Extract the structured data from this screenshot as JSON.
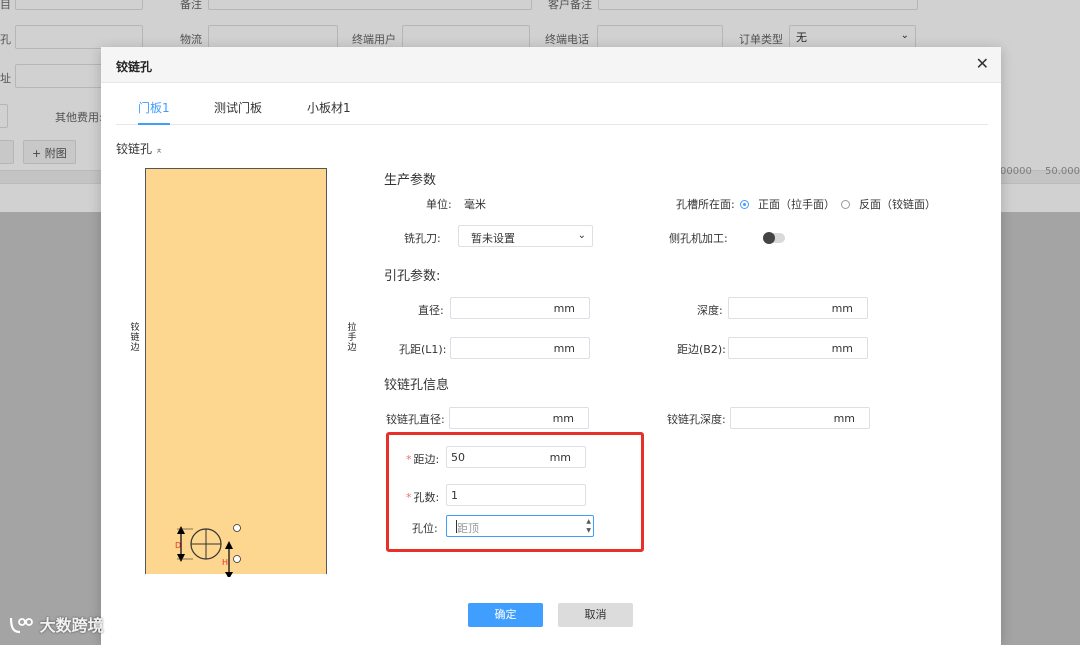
{
  "background": {
    "row1_left": "目",
    "row1_label_mid": "备注",
    "row1_label_right": "客户备注",
    "row2_left": "孔",
    "logistics_label": "物流",
    "end_user_label": "终端用户",
    "end_phone_label": "终端电话",
    "order_type_label": "订单类型",
    "order_type_value": "无",
    "row3_left": "址",
    "other_fee_label": "其他费用:",
    "attach_button": "+ 附图",
    "num_a": "00000",
    "num_b": "50.000"
  },
  "dialog": {
    "title": "铰链孔",
    "close_glyph": "✕",
    "tabs": [
      {
        "label": "门板1",
        "active": true
      },
      {
        "label": "测试门板",
        "active": false
      },
      {
        "label": "小板材1",
        "active": false
      }
    ],
    "section_label": "铰链孔",
    "section_label_mark": "ㅊ",
    "preview": {
      "left_edge_label": "铰链边",
      "right_edge_label": "拉手边",
      "dim_d": "D",
      "dim_h": "H"
    },
    "production": {
      "title": "生产参数",
      "unit_label": "单位:",
      "unit_value": "毫米",
      "slot_face_label": "孔槽所在面:",
      "slot_face_options": [
        {
          "label": "正面（拉手面）",
          "checked": true
        },
        {
          "label": "反面（铰链面）",
          "checked": false
        }
      ],
      "cutter_label": "铣孔刀:",
      "cutter_value": "暂未设置",
      "side_machining_label": "侧孔机加工:",
      "side_machining_on": false
    },
    "guide": {
      "title": "引孔参数:",
      "diameter_label": "直径:",
      "diameter_value": "",
      "depth_label": "深度:",
      "depth_value": "",
      "pitch_label": "孔距(L1):",
      "pitch_value": "",
      "edge_b2_label": "距边(B2):",
      "edge_b2_value": "",
      "unit": "mm"
    },
    "hinge": {
      "title": "铰链孔信息",
      "diameter_label": "铰链孔直径:",
      "diameter_value": "",
      "depth_label": "铰链孔深度:",
      "depth_value": "",
      "edge_label": "距边:",
      "edge_value": "50",
      "count_label": "孔数:",
      "count_value": "1",
      "position_label": "孔位:",
      "position_placeholder": "距顶",
      "required_mark": "*",
      "unit": "mm"
    },
    "confirm_label": "确定",
    "cancel_label": "取消"
  },
  "watermark": "大数跨境",
  "colors": {
    "accent": "#409eff",
    "door_fill": "#fdd68f",
    "highlight_border": "#e8302b",
    "required": "#f56c6c"
  }
}
